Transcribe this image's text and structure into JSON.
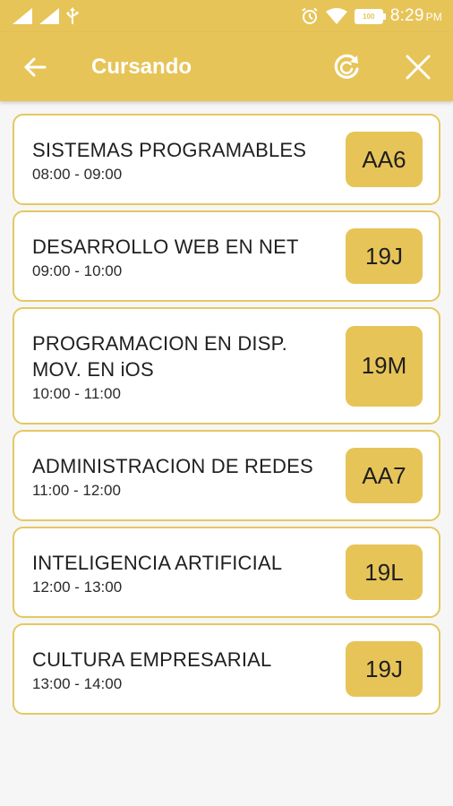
{
  "status_bar": {
    "time": "8:29",
    "ampm": "PM",
    "battery": "100"
  },
  "app_bar": {
    "title": "Cursando"
  },
  "classes": [
    {
      "subject": "SISTEMAS PROGRAMABLES",
      "time": "08:00 - 09:00",
      "room": "AA6"
    },
    {
      "subject": "DESARROLLO WEB EN NET",
      "time": "09:00 - 10:00",
      "room": "19J"
    },
    {
      "subject": "PROGRAMACION EN DISP. MOV. EN iOS",
      "time": "10:00 - 11:00",
      "room": "19M"
    },
    {
      "subject": "ADMINISTRACION DE REDES",
      "time": "11:00 - 12:00",
      "room": "AA7"
    },
    {
      "subject": "INTELIGENCIA ARTIFICIAL",
      "time": "12:00 - 13:00",
      "room": "19L"
    },
    {
      "subject": "CULTURA EMPRESARIAL",
      "time": "13:00 - 14:00",
      "room": "19J"
    }
  ],
  "colors": {
    "accent": "#e7c458",
    "card_border": "#e4c860",
    "background": "#f6f6f6"
  },
  "icons": {
    "back": "arrow-back-icon",
    "refresh": "refresh-icon",
    "close": "close-icon"
  }
}
